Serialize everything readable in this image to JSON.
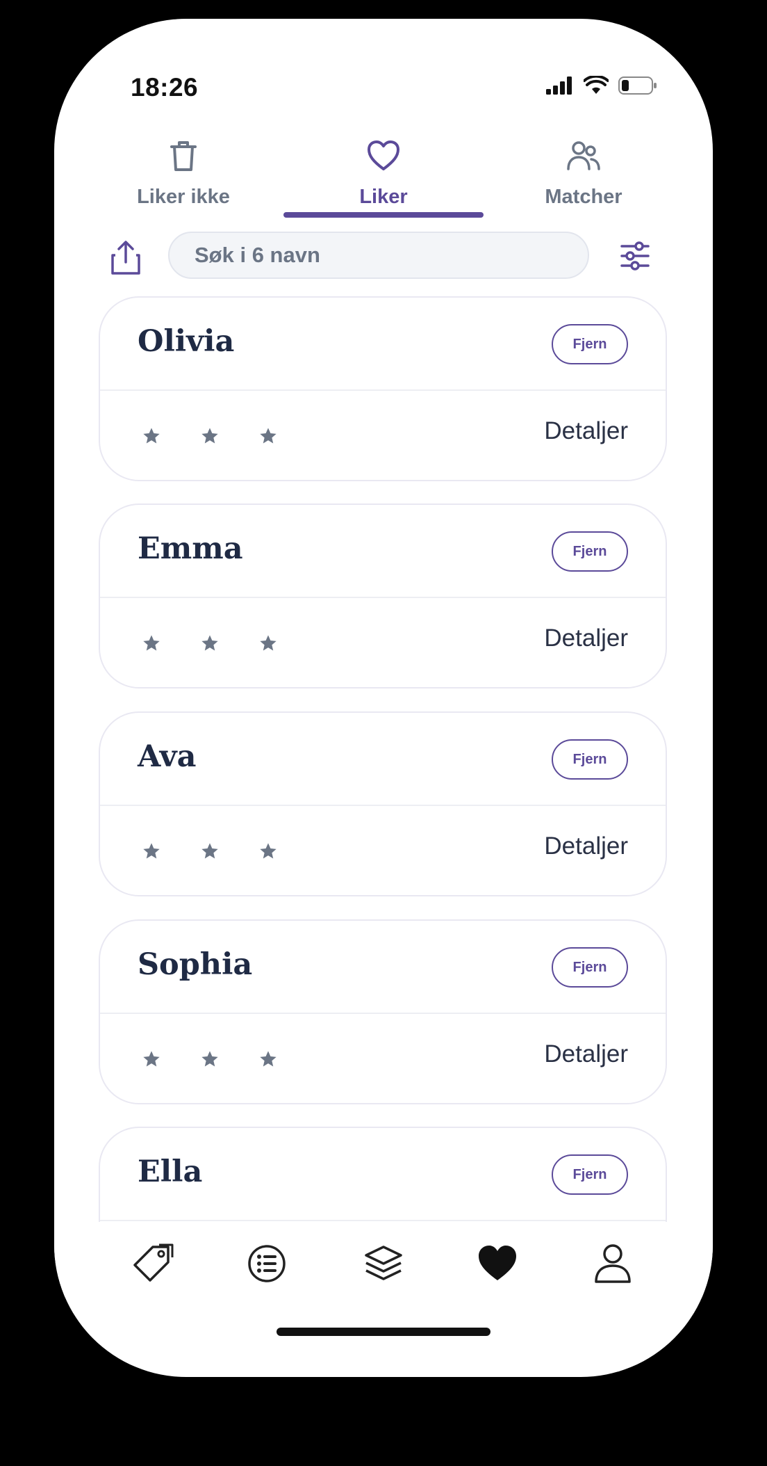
{
  "status_bar": {
    "time": "18:26"
  },
  "tabs": [
    {
      "label": "Liker ikke",
      "icon": "trash-icon",
      "active": false
    },
    {
      "label": "Liker",
      "icon": "heart-outline-icon",
      "active": true
    },
    {
      "label": "Matcher",
      "icon": "users-icon",
      "active": false
    }
  ],
  "search": {
    "placeholder": "Søk i 6 navn"
  },
  "list": {
    "remove_label": "Fjern",
    "details_label": "Detaljer",
    "items": [
      {
        "name": "Olivia"
      },
      {
        "name": "Emma"
      },
      {
        "name": "Ava"
      },
      {
        "name": "Sophia"
      },
      {
        "name": "Ella"
      }
    ]
  },
  "bottom_nav": [
    {
      "icon": "tag-icon"
    },
    {
      "icon": "list-icon"
    },
    {
      "icon": "layers-icon"
    },
    {
      "icon": "heart-filled-icon",
      "active": true
    },
    {
      "icon": "profile-icon"
    }
  ],
  "colors": {
    "accent": "#5b4a99",
    "text_dark": "#1f2a44",
    "muted": "#6b7585"
  }
}
